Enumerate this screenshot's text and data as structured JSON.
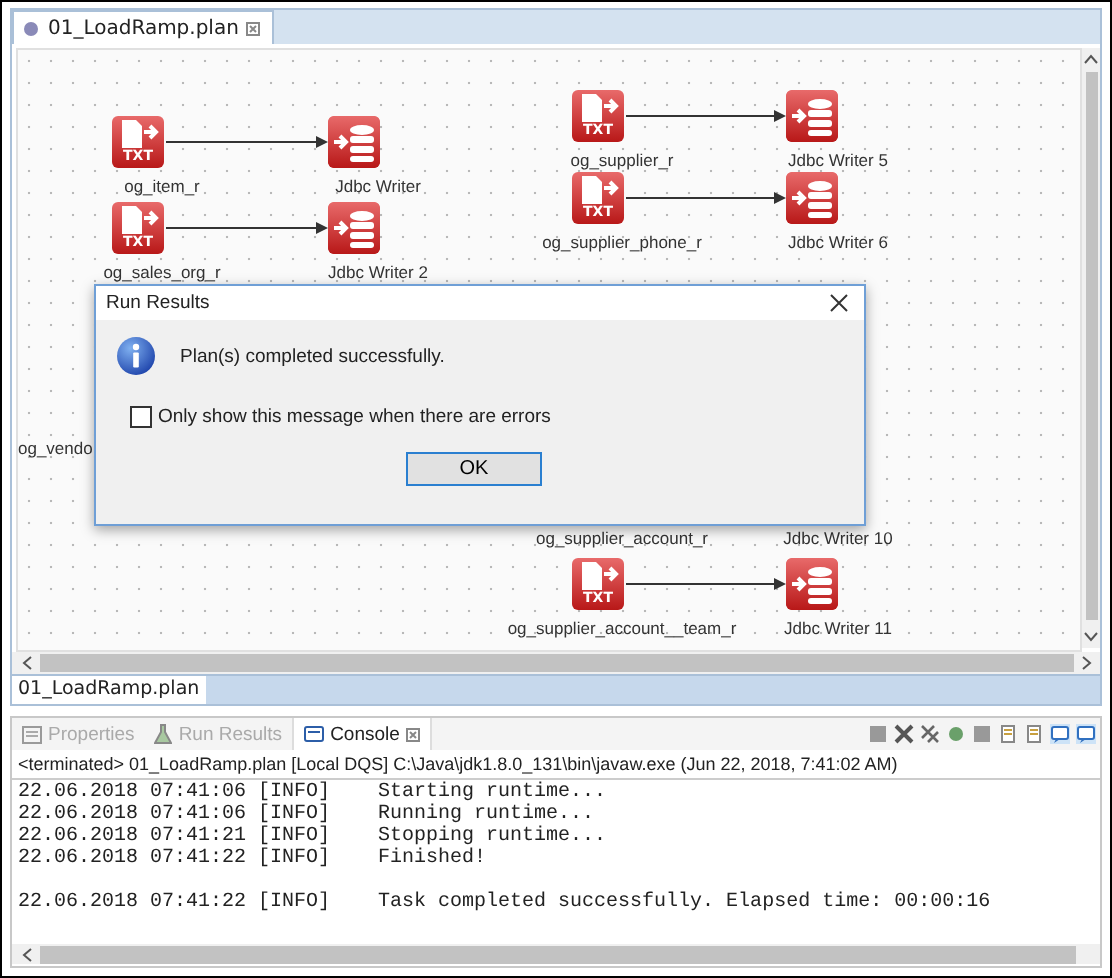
{
  "editor_tab": {
    "title": "01_LoadRamp.plan",
    "selected": true
  },
  "flows": [
    {
      "reader": {
        "name": "og_item_r",
        "badge": "TXT"
      },
      "writer": {
        "name": "Jdbc Writer"
      }
    },
    {
      "reader": {
        "name": "og_sales_org_r",
        "badge": "TXT"
      },
      "writer": {
        "name": "Jdbc Writer 2"
      }
    },
    {
      "reader": {
        "name": "og_supplier_r",
        "badge": "TXT"
      },
      "writer": {
        "name": "Jdbc Writer 5"
      }
    },
    {
      "reader": {
        "name": "og_supplier_phone_r",
        "badge": "TXT"
      },
      "writer": {
        "name": "Jdbc Writer 6"
      }
    },
    {
      "reader": {
        "name": "og_supplier_account_r"
      },
      "writer": {
        "name": "Jdbc Writer 10"
      }
    },
    {
      "reader": {
        "name": "og_supplier_account__team_r",
        "badge": "TXT"
      },
      "writer": {
        "name": "Jdbc Writer 11"
      }
    }
  ],
  "cut_label": "og_vendo",
  "dialog": {
    "title": "Run Results",
    "message": "Plan(s) completed successfully.",
    "checkbox": {
      "label": "Only show this message when there are errors",
      "checked": false
    },
    "button": "OK"
  },
  "bottom_editor_tab": "01_LoadRamp.plan",
  "panel_tabs": [
    {
      "label": "Properties",
      "selected": false
    },
    {
      "label": "Run Results",
      "selected": false
    },
    {
      "label": "Console",
      "selected": true
    }
  ],
  "console": {
    "header": "<terminated> 01_LoadRamp.plan [Local DQS] C:\\Java\\jdk1.8.0_131\\bin\\javaw.exe (Jun 22, 2018, 7:41:02 AM)",
    "lines": [
      {
        "time": "22.06.2018 07:41:06",
        "level": "[INFO]",
        "gap_before": false,
        "message": "Starting runtime..."
      },
      {
        "time": "22.06.2018 07:41:06",
        "level": "[INFO]",
        "gap_before": false,
        "message": "Running runtime..."
      },
      {
        "time": "22.06.2018 07:41:21",
        "level": "[INFO]",
        "gap_before": false,
        "message": "Stopping runtime..."
      },
      {
        "time": "22.06.2018 07:41:22",
        "level": "[INFO]",
        "gap_before": false,
        "message": "Finished!"
      },
      {
        "time": "22.06.2018 07:41:22",
        "level": "[INFO]",
        "gap_before": true,
        "message": "Task completed successfully. Elapsed time: 00:00:16"
      }
    ]
  }
}
